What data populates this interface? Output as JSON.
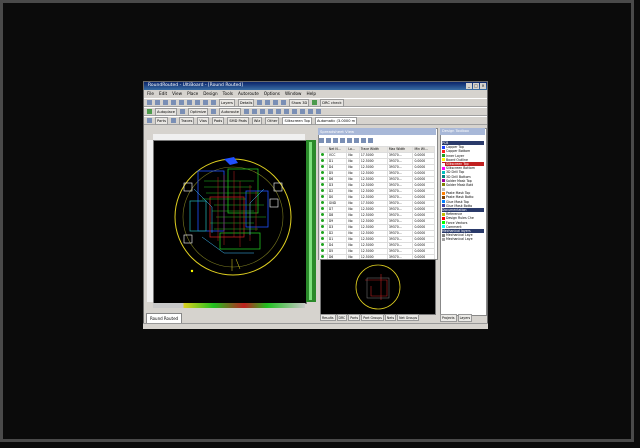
{
  "window": {
    "title": "RoundRouted - UltiBoard - [Round Routed]",
    "controls": [
      "_",
      "□",
      "×"
    ]
  },
  "menu": [
    "File",
    "Edit",
    "View",
    "Place",
    "Design",
    "Tools",
    "Autoroute",
    "Options",
    "Window",
    "Help"
  ],
  "toolbar1": {
    "layers_label": "Layers",
    "details_label": "Details",
    "show3d_label": "Show 3D",
    "drc_label": "DRC check"
  },
  "toolbar2": {
    "autoplace_label": "Autoplace",
    "optimize_label": "Optimize",
    "autoroute_label": "Autoroute"
  },
  "toolbar3": {
    "parts_label": "Parts",
    "traces_label": "Traces",
    "vias_label": "Vias",
    "pads_label": "Pads",
    "smd_label": "SMD Pads",
    "wiz_label": "Wiz",
    "other_label": "Other",
    "layer_select": "Silkscreen Top",
    "mode_select": "Automatic (3.0000 m"
  },
  "document_tab": "Round Routed",
  "spreadsheet": {
    "title": "Spreadsheet View",
    "columns": [
      "",
      "Net N...",
      "Lo...",
      "Trace Width",
      "Max Width",
      "Min Wi..."
    ],
    "rows": [
      [
        "VCC",
        "No",
        "17.5000",
        "39370...",
        "0.0000"
      ],
      [
        "D1",
        "No",
        "12.5000",
        "39370...",
        "0.0000"
      ],
      [
        "D4",
        "No",
        "12.5000",
        "39370...",
        "0.0000"
      ],
      [
        "D5",
        "No",
        "12.5000",
        "39370...",
        "0.0000"
      ],
      [
        "D6",
        "No",
        "12.5000",
        "39370...",
        "0.0000"
      ],
      [
        "D3",
        "No",
        "12.5000",
        "39370...",
        "0.0000"
      ],
      [
        "D2",
        "No",
        "12.5000",
        "39370...",
        "0.0000"
      ],
      [
        "D0",
        "No",
        "12.5000",
        "39370...",
        "0.0000"
      ],
      [
        "GND",
        "No",
        "17.5000",
        "39370...",
        "0.0000"
      ],
      [
        "D7",
        "No",
        "12.5000",
        "39370...",
        "0.0000"
      ],
      [
        "D8",
        "No",
        "12.5000",
        "39370...",
        "0.0000"
      ],
      [
        "D9",
        "No",
        "12.5000",
        "39370...",
        "0.0000"
      ],
      [
        "D3",
        "No",
        "12.5000",
        "39370...",
        "0.0000"
      ],
      [
        "D2",
        "No",
        "12.5000",
        "39370...",
        "0.0000"
      ],
      [
        "D1",
        "No",
        "12.5000",
        "39370...",
        "0.0000"
      ],
      [
        "D4",
        "No",
        "12.5000",
        "39370...",
        "0.0000"
      ],
      [
        "D5",
        "No",
        "12.5000",
        "39370...",
        "0.0000"
      ],
      [
        "D6",
        "No",
        "12.5000",
        "39370...",
        "0.0000"
      ]
    ],
    "tabs": [
      "Results",
      "DRC",
      "Parts",
      "Part Groups",
      "Nets",
      "Net Groups"
    ]
  },
  "layers_panel": {
    "title": "Design Toolbox",
    "groups": [
      {
        "label": "PCB",
        "type": "group"
      },
      {
        "label": "Copper Top",
        "color": "#2040ff"
      },
      {
        "label": "Copper Bottom",
        "color": "#ff2020"
      },
      {
        "label": "Inner Layer",
        "color": "#20a020"
      },
      {
        "label": "Board Outline",
        "color": "#ffff00"
      },
      {
        "label": "Silkscreen Top",
        "color": "#ffffff",
        "selected": true
      },
      {
        "label": "Silkscreen Bottom",
        "color": "#ff00ff"
      },
      {
        "label": "3D Drill Top",
        "color": "#00c0c0"
      },
      {
        "label": "3D Drill Bottom",
        "color": "#008080"
      },
      {
        "label": "Solder Mask Top",
        "color": "#a000a0"
      },
      {
        "label": "Solder Mask Bott",
        "color": "#808000"
      },
      {
        "label": "",
        "color": "#c0c0c0"
      },
      {
        "label": "Paste Mask Top",
        "color": "#ff8000"
      },
      {
        "label": "Paste Mask Botto",
        "color": "#804000"
      },
      {
        "label": "Glue Mask Top",
        "color": "#0080ff"
      },
      {
        "label": "Glue Mask Botto",
        "color": "#4040a0"
      },
      {
        "label": "Documentation",
        "type": "group"
      },
      {
        "label": "Reference",
        "color": "#c0c000"
      },
      {
        "label": "Design Rules Che",
        "color": "#ff0000"
      },
      {
        "label": "Force Vectors",
        "color": "#00ff00"
      },
      {
        "label": "Comment",
        "color": "#00ffff"
      },
      {
        "label": "Mechanical layers",
        "type": "group"
      },
      {
        "label": "Mechanical Laye",
        "color": "#808080"
      },
      {
        "label": "Mechanical Laye",
        "color": "#a0a0a0"
      }
    ],
    "tabs": [
      "Projects",
      "Layers"
    ]
  },
  "colors": {
    "titlebar": "#0a246a",
    "board_bg": "#000000",
    "board_outline": "#e0d020",
    "selected_layer": "#c02020"
  }
}
